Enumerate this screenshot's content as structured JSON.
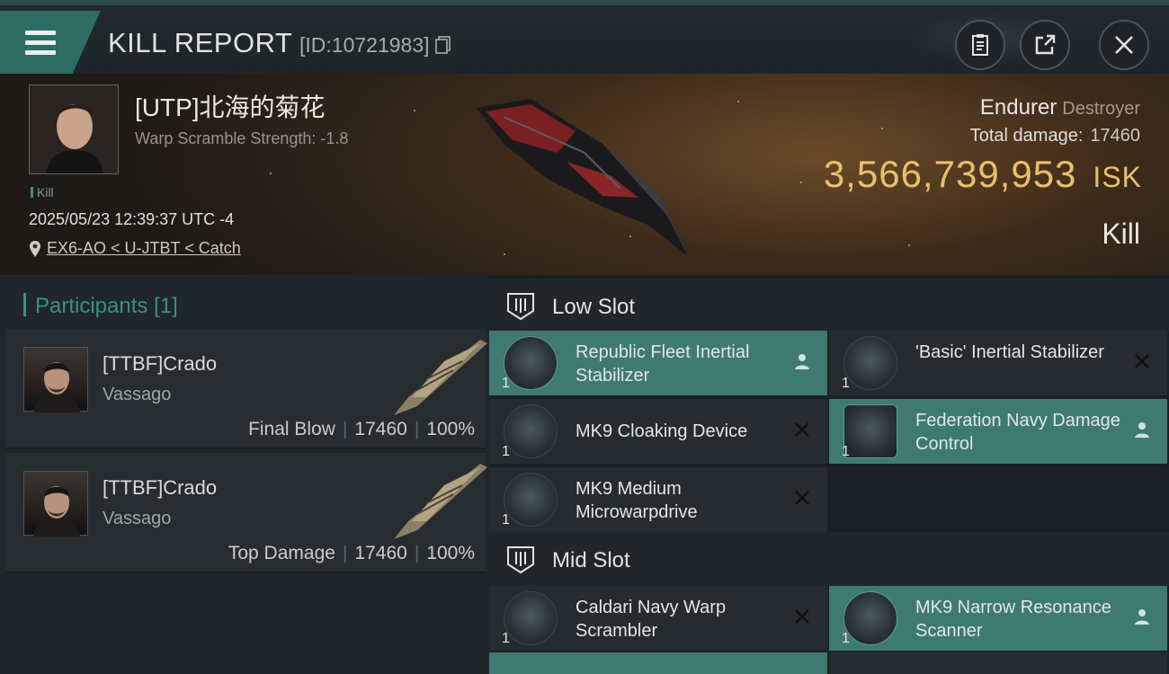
{
  "header": {
    "title": "KILL REPORT",
    "report_id": "[ID:10721983]"
  },
  "victim": {
    "pilot": "[UTP]北海的菊花",
    "warp_scramble": "Warp Scramble Strength: -1.8",
    "tag": "Kill",
    "datetime": "2025/05/23 12:39:37 UTC -4",
    "location": "EX6-AO < U-JTBT < Catch",
    "ship_name": "Endurer",
    "ship_class": "Destroyer",
    "total_damage_label": "Total damage:",
    "total_damage": "17460",
    "isk_value": "3,566,739,953",
    "isk_unit": "ISK",
    "result": "Kill"
  },
  "participants": {
    "heading": "Participants",
    "count": "[1]",
    "items": [
      {
        "name": "[TTBF]Crado",
        "ship": "Vassago",
        "role": "Final Blow",
        "damage": "17460",
        "percent": "100%"
      },
      {
        "name": "[TTBF]Crado",
        "ship": "Vassago",
        "role": "Top Damage",
        "damage": "17460",
        "percent": "100%"
      }
    ]
  },
  "slots": {
    "low": {
      "label": "Low Slot",
      "modules": [
        {
          "name": "Republic Fleet Inertial Stabilizer",
          "qty": "1",
          "status": "dropped"
        },
        {
          "name": "'Basic' Inertial Stabilizer",
          "qty": "1",
          "status": "destroyed"
        },
        {
          "name": "MK9 Cloaking Device",
          "qty": "1",
          "status": "destroyed"
        },
        {
          "name": "Federation Navy Damage Control",
          "qty": "1",
          "status": "dropped"
        },
        {
          "name": "MK9 Medium Microwarpdrive",
          "qty": "1",
          "status": "destroyed"
        }
      ]
    },
    "mid": {
      "label": "Mid Slot",
      "modules": [
        {
          "name": "Caldari Navy Warp Scrambler",
          "qty": "1",
          "status": "destroyed"
        },
        {
          "name": "MK9 Narrow Resonance Scanner",
          "qty": "1",
          "status": "dropped"
        }
      ]
    }
  },
  "colors": {
    "accent": "#3f7a72",
    "isk": "#e8c06a",
    "participants_heading": "#3a8f85"
  }
}
